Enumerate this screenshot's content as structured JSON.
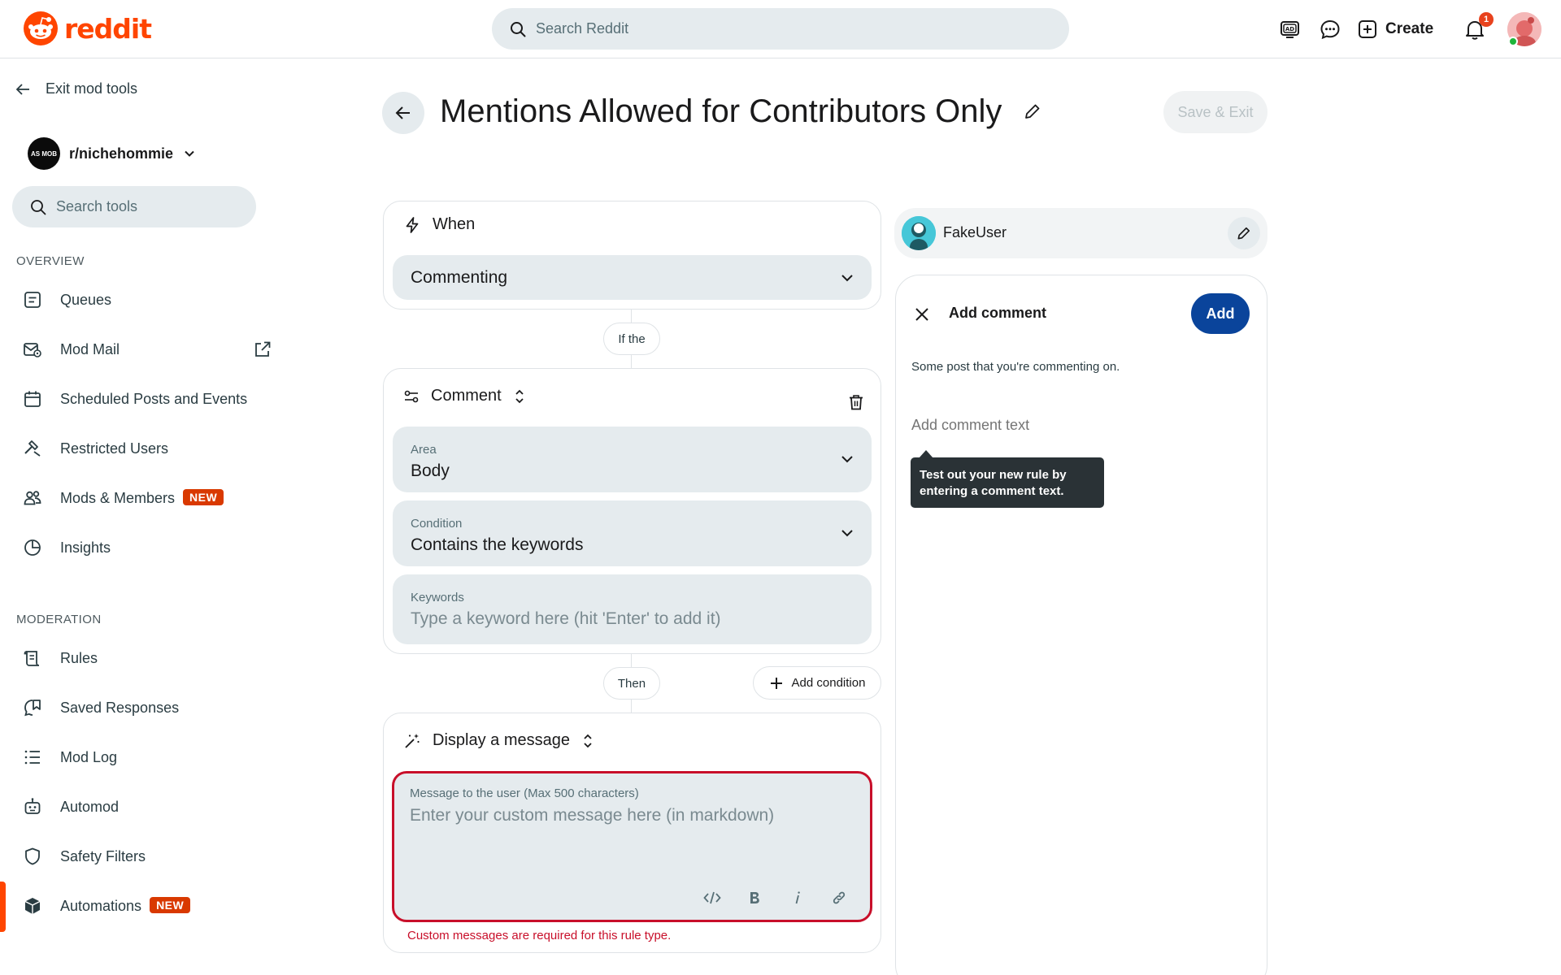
{
  "header": {
    "logo_text": "reddit",
    "search_placeholder": "Search Reddit",
    "create_label": "Create",
    "notification_count": "1",
    "icons": [
      "advertise-icon",
      "chat-icon",
      "create-icon",
      "bell-icon",
      "user-avatar"
    ]
  },
  "sidebar": {
    "exit_label": "Exit mod tools",
    "community": {
      "name": "r/nichehommie",
      "avatar_text": "AS MOB"
    },
    "search_placeholder": "Search tools",
    "overview_label": "OVERVIEW",
    "overview_items": [
      {
        "label": "Queues",
        "icon": "queue-icon"
      },
      {
        "label": "Mod Mail",
        "icon": "modmail-icon"
      },
      {
        "label": "Scheduled Posts and Events",
        "icon": "calendar-icon"
      },
      {
        "label": "Restricted Users",
        "icon": "hammer-icon"
      },
      {
        "label": "Mods & Members",
        "icon": "members-icon",
        "badge": "NEW"
      },
      {
        "label": "Insights",
        "icon": "insights-icon"
      }
    ],
    "moderation_label": "MODERATION",
    "moderation_items": [
      {
        "label": "Rules",
        "icon": "rules-icon"
      },
      {
        "label": "Saved Responses",
        "icon": "saved-responses-icon"
      },
      {
        "label": "Mod Log",
        "icon": "modlog-icon"
      },
      {
        "label": "Automod",
        "icon": "automod-icon"
      },
      {
        "label": "Safety Filters",
        "icon": "shield-icon"
      },
      {
        "label": "Automations",
        "icon": "automations-icon",
        "badge": "NEW",
        "active": true
      }
    ]
  },
  "page": {
    "title": "Mentions Allowed for Contributors Only",
    "save_exit_label": "Save & Exit"
  },
  "rule": {
    "when_label": "When",
    "trigger_value": "Commenting",
    "if_label": "If the",
    "comment_label": "Comment",
    "area": {
      "label": "Area",
      "value": "Body"
    },
    "condition": {
      "label": "Condition",
      "value": "Contains the keywords"
    },
    "keywords": {
      "label": "Keywords",
      "placeholder": "Type a keyword here (hit 'Enter' to add it)"
    },
    "then_label": "Then",
    "add_condition_label": "Add condition",
    "action_label": "Display a message",
    "message": {
      "label": "Message to the user (Max 500 characters)",
      "placeholder": "Enter your custom message here (in markdown)"
    },
    "error": "Custom messages are required for this rule type.",
    "error_color": "#c80f2a"
  },
  "preview": {
    "username": "FakeUser",
    "title": "Add comment",
    "add_label": "Add",
    "post_text": "Some post that you're commenting on.",
    "comment_placeholder": "Add comment text",
    "tooltip": "Test out your new rule by entering a comment text."
  },
  "colors": {
    "brand": "#ff4500",
    "primary_button": "#0a449b",
    "badge": "#d93900"
  }
}
